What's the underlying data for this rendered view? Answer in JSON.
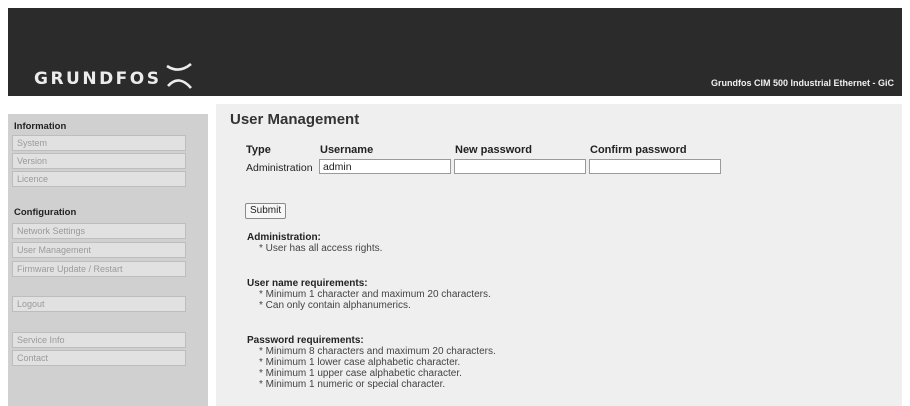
{
  "header": {
    "logo": "GRUNDFOS",
    "product": "Grundfos CIM 500 Industrial Ethernet - GiC"
  },
  "sidebar": {
    "information": {
      "title": "Information",
      "items": [
        "System",
        "Version",
        "Licence"
      ]
    },
    "configuration": {
      "title": "Configuration",
      "items": [
        "Network Settings",
        "User Management",
        "Firmware Update / Restart"
      ]
    },
    "logout": "Logout",
    "other": [
      "Service Info",
      "Contact"
    ]
  },
  "main": {
    "title": "User Management",
    "table": {
      "headers": [
        "Type",
        "Username",
        "New password",
        "Confirm password"
      ],
      "row": {
        "type": "Administration",
        "username": "admin",
        "new_password": "",
        "confirm_password": ""
      }
    },
    "submit_label": "Submit",
    "admin_block": {
      "heading": "Administration:",
      "lines": [
        "* User has all access rights."
      ]
    },
    "username_block": {
      "heading": "User name requirements:",
      "lines": [
        "* Minimum 1 character and maximum 20 characters.",
        "* Can only contain alphanumerics."
      ]
    },
    "password_block": {
      "heading": "Password requirements:",
      "lines": [
        "* Minimum 8 characters and maximum 20 characters.",
        "* Minimum 1 lower case alphabetic character.",
        "* Minimum 1 upper case alphabetic character.",
        "* Minimum 1 numeric or special character."
      ]
    }
  }
}
